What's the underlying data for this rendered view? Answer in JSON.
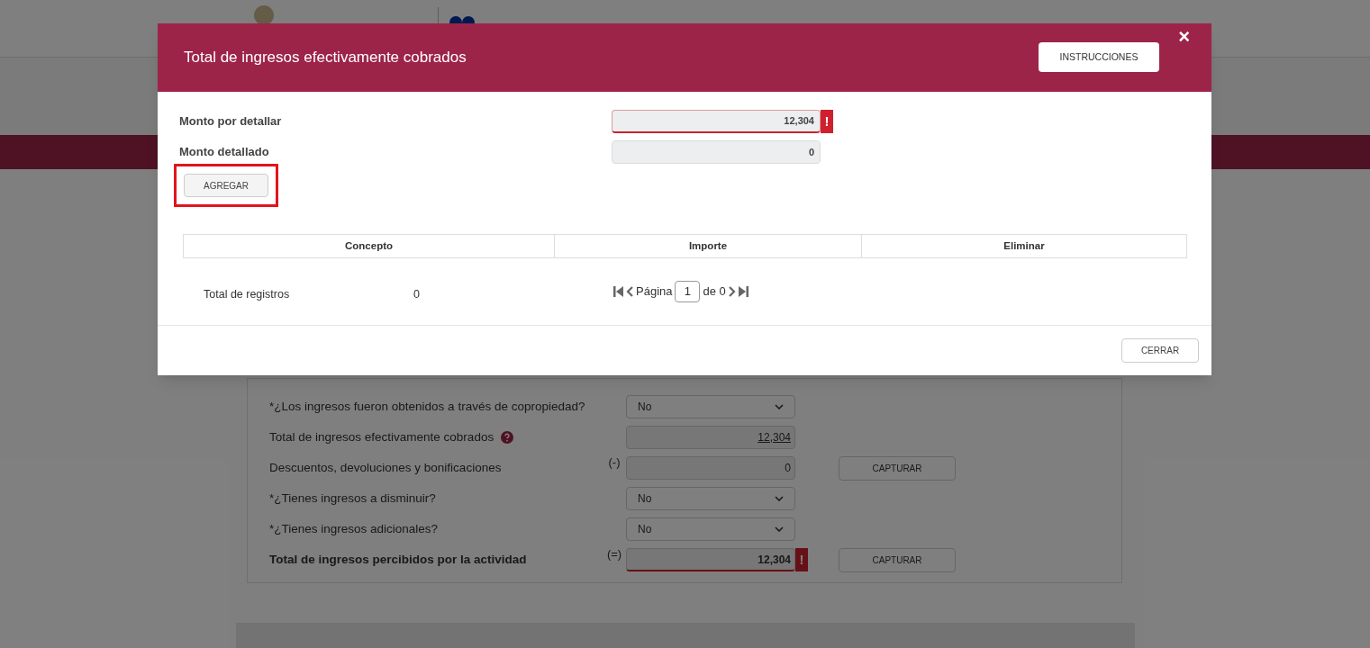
{
  "form": {
    "rows": [
      {
        "kind": "select",
        "label": "*¿Los ingresos fueron obtenidos a través de copropiedad?",
        "value": "No"
      },
      {
        "kind": "amount",
        "label": "Total de ingresos efectivamente cobrados",
        "help": true,
        "value": "12,304",
        "linked": true,
        "error": false
      },
      {
        "kind": "amount",
        "label": "Descuentos, devoluciones y bonificaciones",
        "sign": "(-)",
        "value": "0",
        "error": false,
        "button": "CAPTURAR"
      },
      {
        "kind": "select",
        "label": "*¿Tienes ingresos a disminuir?",
        "value": "No"
      },
      {
        "kind": "select",
        "label": "*¿Tienes ingresos adicionales?",
        "value": "No"
      },
      {
        "kind": "amount",
        "label": "Total de ingresos percibidos por la actividad",
        "bold": true,
        "sign": "(=)",
        "value": "12,304",
        "error": true,
        "error_mark": "!",
        "button": "CAPTURAR"
      }
    ]
  },
  "modal": {
    "title": "Total de ingresos efectivamente cobrados",
    "instructions_button": "INSTRUCCIONES",
    "close": "×",
    "fields": [
      {
        "label": "Monto por detallar",
        "value": "12,304",
        "error": true,
        "error_mark": "!"
      },
      {
        "label": "Monto detallado",
        "value": "0",
        "error": false
      }
    ],
    "add_button": {
      "label": "AGREGAR",
      "highlighted": true
    },
    "table": {
      "columns": [
        "Concepto",
        "Importe",
        "Eliminar"
      ]
    },
    "records_label": "Total de registros",
    "records_count": "0",
    "pagination": {
      "page_label": "Página",
      "page": "1",
      "of_label": "de 0"
    },
    "close_button": "CERRAR"
  }
}
